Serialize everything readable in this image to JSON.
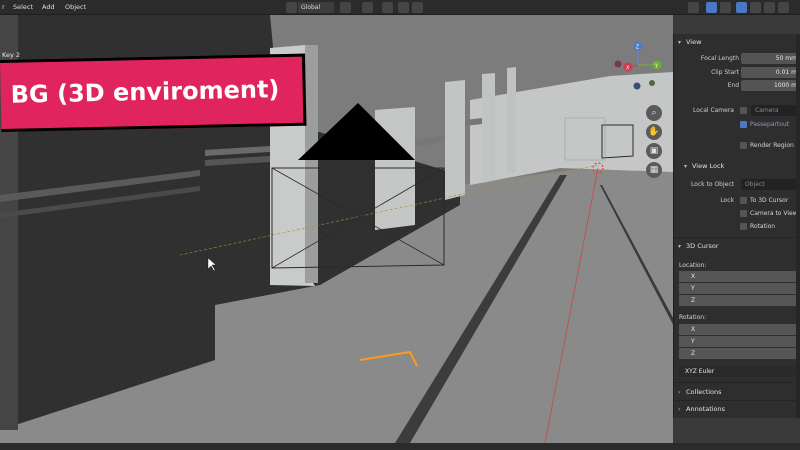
{
  "header": {
    "menus": [
      "View",
      "Select",
      "Add",
      "Object"
    ],
    "menu_view_partial": "r",
    "transform_orientation": "Global",
    "icons": [
      "object-mode-icon",
      "orientation-icon",
      "pivot-icon",
      "snap-icon",
      "proportional-icon",
      "gizmo-icon",
      "overlay-icon",
      "xray-icon",
      "shading-icon"
    ]
  },
  "viewport": {
    "key_label": "Key 2",
    "banner_text": "BG (3D enviroment)",
    "colors": {
      "banner": "#e0245e",
      "floor": "#8d8d8d",
      "wall_light": "#c6c8c8",
      "wall_dark": "#2e2e2e",
      "cursor_orange": "#ff9a1f"
    },
    "gizmo": {
      "x": "X",
      "y": "Y",
      "z": "Z"
    },
    "nav_tools": [
      "zoom-icon",
      "hand-pan-icon",
      "camera-view-icon",
      "grid-view-icon"
    ]
  },
  "sidebar": {
    "view": {
      "title": "View",
      "focal_length_label": "Focal Length",
      "focal_length_value": "50 mm",
      "clip_start_label": "Clip Start",
      "clip_start_value": "0.01 m",
      "end_label": "End",
      "end_value": "1000 m",
      "local_camera_label": "Local Camera",
      "local_camera_value": "Camera",
      "passepartout_label": "Passepartout",
      "render_region_label": "Render Region"
    },
    "view_lock": {
      "title": "View Lock",
      "lock_to_object_label": "Lock to Object",
      "lock_to_object_placeholder": "Object",
      "lock_label": "Lock",
      "to_3d_cursor_label": "To 3D Cursor",
      "camera_to_view_label": "Camera to View",
      "rotation_label": "Rotation"
    },
    "cursor_3d": {
      "title": "3D Cursor",
      "location_label": "Location:",
      "location_axes": [
        "X",
        "Y",
        "Z"
      ],
      "rotation_label": "Rotation:",
      "rotation_axes": [
        "X",
        "Y",
        "Z"
      ],
      "rotation_mode": "XYZ Euler"
    },
    "collections_title": "Collections",
    "annotations_title": "Annotations"
  }
}
